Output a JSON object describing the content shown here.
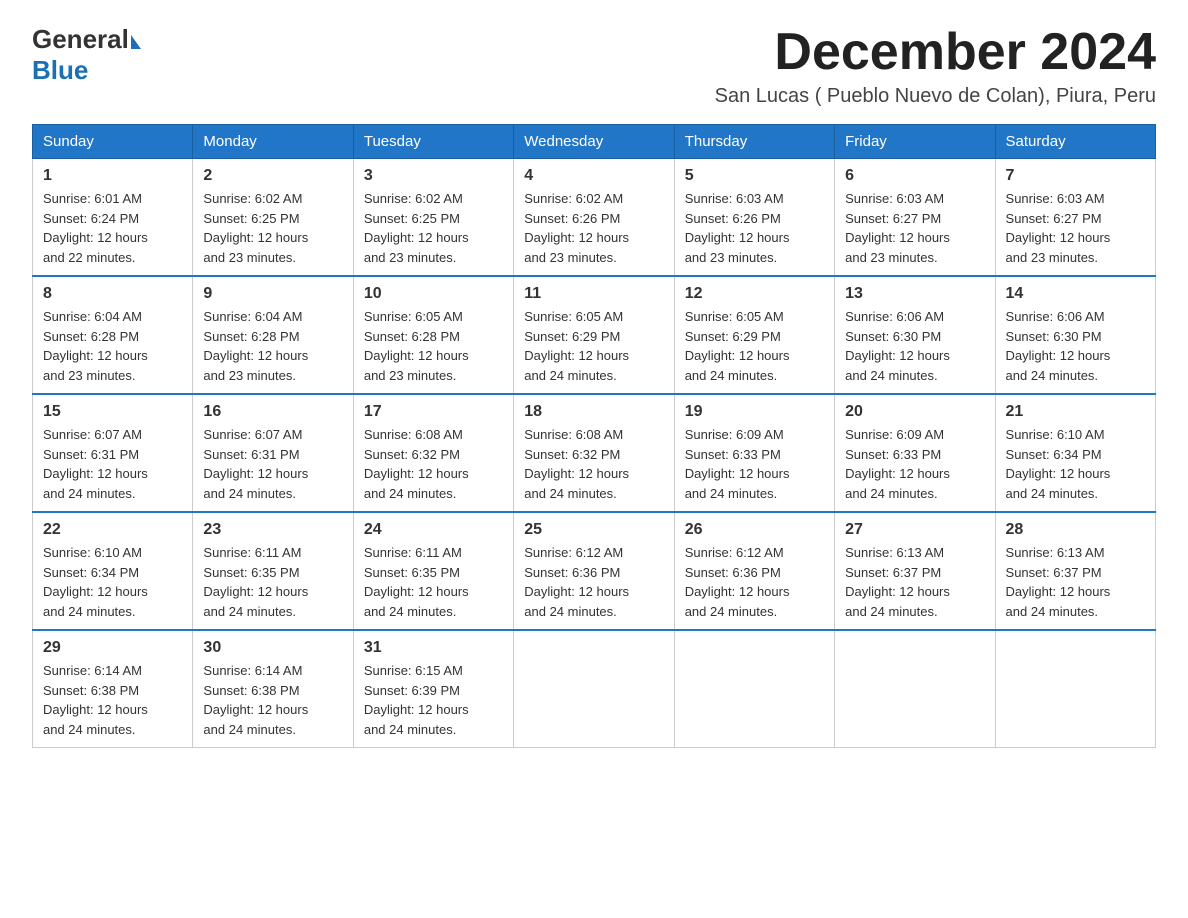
{
  "logo": {
    "text_general": "General",
    "text_blue": "Blue",
    "triangle": "▶"
  },
  "title": "December 2024",
  "subtitle": "San Lucas ( Pueblo Nuevo de Colan), Piura, Peru",
  "days_of_week": [
    "Sunday",
    "Monday",
    "Tuesday",
    "Wednesday",
    "Thursday",
    "Friday",
    "Saturday"
  ],
  "weeks": [
    [
      {
        "day": "1",
        "sunrise": "6:01 AM",
        "sunset": "6:24 PM",
        "daylight": "12 hours and 22 minutes."
      },
      {
        "day": "2",
        "sunrise": "6:02 AM",
        "sunset": "6:25 PM",
        "daylight": "12 hours and 23 minutes."
      },
      {
        "day": "3",
        "sunrise": "6:02 AM",
        "sunset": "6:25 PM",
        "daylight": "12 hours and 23 minutes."
      },
      {
        "day": "4",
        "sunrise": "6:02 AM",
        "sunset": "6:26 PM",
        "daylight": "12 hours and 23 minutes."
      },
      {
        "day": "5",
        "sunrise": "6:03 AM",
        "sunset": "6:26 PM",
        "daylight": "12 hours and 23 minutes."
      },
      {
        "day": "6",
        "sunrise": "6:03 AM",
        "sunset": "6:27 PM",
        "daylight": "12 hours and 23 minutes."
      },
      {
        "day": "7",
        "sunrise": "6:03 AM",
        "sunset": "6:27 PM",
        "daylight": "12 hours and 23 minutes."
      }
    ],
    [
      {
        "day": "8",
        "sunrise": "6:04 AM",
        "sunset": "6:28 PM",
        "daylight": "12 hours and 23 minutes."
      },
      {
        "day": "9",
        "sunrise": "6:04 AM",
        "sunset": "6:28 PM",
        "daylight": "12 hours and 23 minutes."
      },
      {
        "day": "10",
        "sunrise": "6:05 AM",
        "sunset": "6:28 PM",
        "daylight": "12 hours and 23 minutes."
      },
      {
        "day": "11",
        "sunrise": "6:05 AM",
        "sunset": "6:29 PM",
        "daylight": "12 hours and 24 minutes."
      },
      {
        "day": "12",
        "sunrise": "6:05 AM",
        "sunset": "6:29 PM",
        "daylight": "12 hours and 24 minutes."
      },
      {
        "day": "13",
        "sunrise": "6:06 AM",
        "sunset": "6:30 PM",
        "daylight": "12 hours and 24 minutes."
      },
      {
        "day": "14",
        "sunrise": "6:06 AM",
        "sunset": "6:30 PM",
        "daylight": "12 hours and 24 minutes."
      }
    ],
    [
      {
        "day": "15",
        "sunrise": "6:07 AM",
        "sunset": "6:31 PM",
        "daylight": "12 hours and 24 minutes."
      },
      {
        "day": "16",
        "sunrise": "6:07 AM",
        "sunset": "6:31 PM",
        "daylight": "12 hours and 24 minutes."
      },
      {
        "day": "17",
        "sunrise": "6:08 AM",
        "sunset": "6:32 PM",
        "daylight": "12 hours and 24 minutes."
      },
      {
        "day": "18",
        "sunrise": "6:08 AM",
        "sunset": "6:32 PM",
        "daylight": "12 hours and 24 minutes."
      },
      {
        "day": "19",
        "sunrise": "6:09 AM",
        "sunset": "6:33 PM",
        "daylight": "12 hours and 24 minutes."
      },
      {
        "day": "20",
        "sunrise": "6:09 AM",
        "sunset": "6:33 PM",
        "daylight": "12 hours and 24 minutes."
      },
      {
        "day": "21",
        "sunrise": "6:10 AM",
        "sunset": "6:34 PM",
        "daylight": "12 hours and 24 minutes."
      }
    ],
    [
      {
        "day": "22",
        "sunrise": "6:10 AM",
        "sunset": "6:34 PM",
        "daylight": "12 hours and 24 minutes."
      },
      {
        "day": "23",
        "sunrise": "6:11 AM",
        "sunset": "6:35 PM",
        "daylight": "12 hours and 24 minutes."
      },
      {
        "day": "24",
        "sunrise": "6:11 AM",
        "sunset": "6:35 PM",
        "daylight": "12 hours and 24 minutes."
      },
      {
        "day": "25",
        "sunrise": "6:12 AM",
        "sunset": "6:36 PM",
        "daylight": "12 hours and 24 minutes."
      },
      {
        "day": "26",
        "sunrise": "6:12 AM",
        "sunset": "6:36 PM",
        "daylight": "12 hours and 24 minutes."
      },
      {
        "day": "27",
        "sunrise": "6:13 AM",
        "sunset": "6:37 PM",
        "daylight": "12 hours and 24 minutes."
      },
      {
        "day": "28",
        "sunrise": "6:13 AM",
        "sunset": "6:37 PM",
        "daylight": "12 hours and 24 minutes."
      }
    ],
    [
      {
        "day": "29",
        "sunrise": "6:14 AM",
        "sunset": "6:38 PM",
        "daylight": "12 hours and 24 minutes."
      },
      {
        "day": "30",
        "sunrise": "6:14 AM",
        "sunset": "6:38 PM",
        "daylight": "12 hours and 24 minutes."
      },
      {
        "day": "31",
        "sunrise": "6:15 AM",
        "sunset": "6:39 PM",
        "daylight": "12 hours and 24 minutes."
      },
      null,
      null,
      null,
      null
    ]
  ],
  "labels": {
    "sunrise": "Sunrise:",
    "sunset": "Sunset:",
    "daylight": "Daylight:"
  }
}
